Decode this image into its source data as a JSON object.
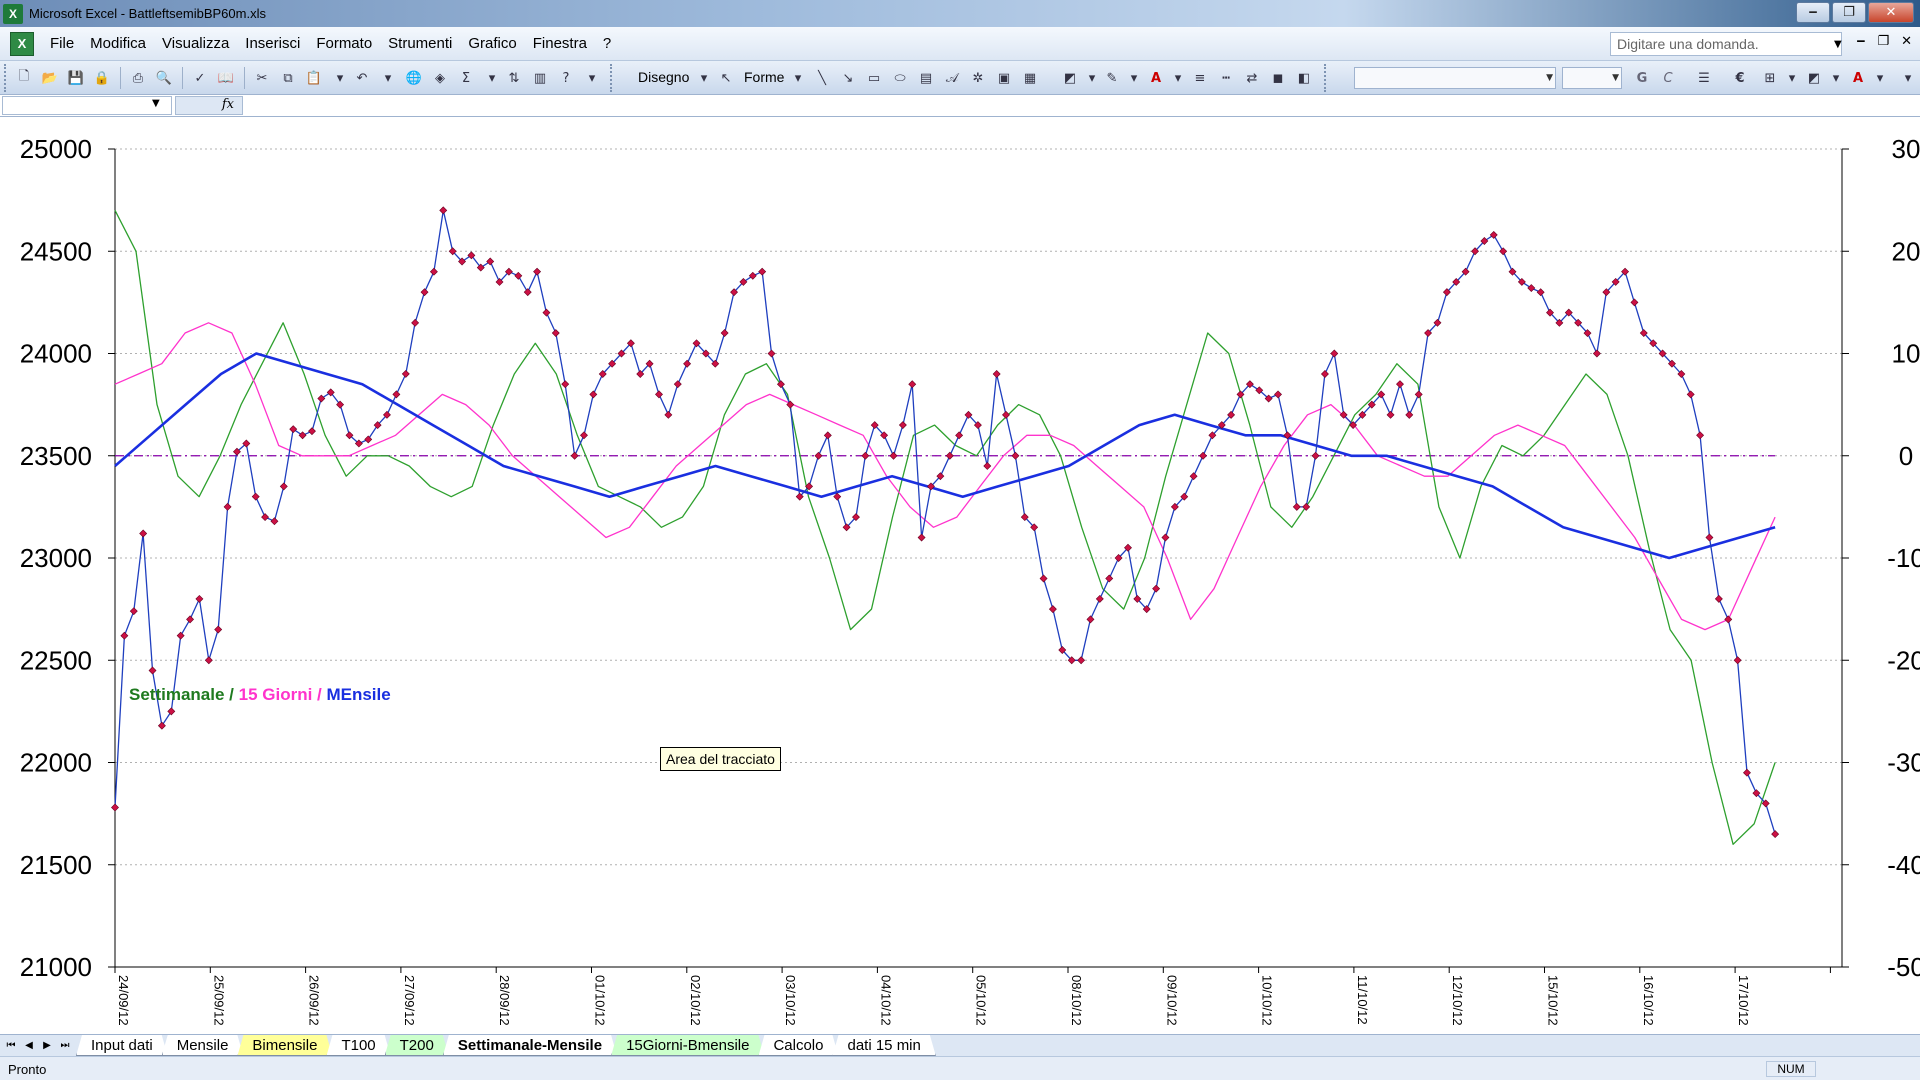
{
  "window": {
    "title": "Microsoft Excel - BattleftsemibBP60m.xls",
    "app_icon": "excel-icon",
    "controls": [
      "minimize-icon",
      "restore-icon",
      "close-icon"
    ]
  },
  "menubar": {
    "items": [
      "File",
      "Modifica",
      "Visualizza",
      "Inserisci",
      "Formato",
      "Strumenti",
      "Grafico",
      "Finestra",
      "?"
    ],
    "ask_placeholder": "Digitare una domanda."
  },
  "toolbar": {
    "draw_label": "Disegno",
    "shapes_label": "Forme",
    "bold_label": "G",
    "italic_label": "C",
    "euro_label": "€",
    "font_color_label": "A"
  },
  "formulabar": {
    "namebox_value": "",
    "fx_label": "fx"
  },
  "colors": {
    "price": "#1f3fbf",
    "markers": "#cc1144",
    "weekly": "#2ea02e",
    "fifteen_days": "#ff33cc",
    "monthly": "#1a2fe0",
    "zero_line": "#8800aa"
  },
  "legend": {
    "weekly": "Settimanale",
    "sep1": " / ",
    "fifteen": "15 Giorni",
    "sep2": " / ",
    "monthly": "MEnsile"
  },
  "tooltip": "Area del tracciato",
  "chart_data": {
    "type": "line",
    "x_dates": [
      "24/09/12",
      "25/09/12",
      "26/09/12",
      "27/09/12",
      "28/09/12",
      "01/10/12",
      "02/10/12",
      "03/10/12",
      "04/10/12",
      "05/10/12",
      "08/10/12",
      "09/10/12",
      "10/10/12",
      "11/10/12",
      "12/10/12",
      "15/10/12",
      "16/10/12",
      "17/10/12"
    ],
    "y_left": {
      "min": 21000,
      "max": 25000,
      "ticks": [
        21000,
        21500,
        22000,
        22500,
        23000,
        23500,
        24000,
        24500,
        25000
      ]
    },
    "y_right": {
      "min": -50,
      "max": 30,
      "ticks": [
        -50,
        -40,
        -30,
        -20,
        -10,
        0,
        10,
        20,
        30
      ]
    },
    "grid": true,
    "series": [
      {
        "role": "price",
        "axis": "left",
        "values": [
          21780,
          22620,
          22740,
          23120,
          22450,
          22180,
          22250,
          22620,
          22700,
          22800,
          22500,
          22650,
          23250,
          23520,
          23560,
          23300,
          23200,
          23180,
          23350,
          23630,
          23600,
          23620,
          23780,
          23810,
          23750,
          23600,
          23560,
          23580,
          23650,
          23700,
          23800,
          23900,
          24150,
          24300,
          24400,
          24700,
          24500,
          24450,
          24480,
          24420,
          24450,
          24350,
          24400,
          24380,
          24300,
          24400,
          24200,
          24100,
          23850,
          23500,
          23600,
          23800,
          23900,
          23950,
          24000,
          24050,
          23900,
          23950,
          23800,
          23700,
          23850,
          23950,
          24050,
          24000,
          23950,
          24100,
          24300,
          24350,
          24380,
          24400,
          24000,
          23850,
          23750,
          23300,
          23350,
          23500,
          23600,
          23300,
          23150,
          23200,
          23500,
          23650,
          23600,
          23500,
          23650,
          23850,
          23100,
          23350,
          23400,
          23500,
          23600,
          23700,
          23650,
          23450,
          23900,
          23700,
          23500,
          23200,
          23150,
          22900,
          22750,
          22550,
          22500,
          22500,
          22700,
          22800,
          22900,
          23000,
          23050,
          22800,
          22750,
          22850,
          23100,
          23250,
          23300,
          23400,
          23500,
          23600,
          23650,
          23700,
          23800,
          23850,
          23820,
          23780,
          23800,
          23600,
          23250,
          23250,
          23500,
          23900,
          24000,
          23700,
          23650,
          23700,
          23750,
          23800,
          23700,
          23850,
          23700,
          23800,
          24100,
          24150,
          24300,
          24350,
          24400,
          24500,
          24550,
          24580,
          24500,
          24400,
          24350,
          24320,
          24300,
          24200,
          24150,
          24200,
          24150,
          24100,
          24000,
          24300,
          24350,
          24400,
          24250,
          24100,
          24050,
          24000,
          23950,
          23900,
          23800,
          23600,
          23100,
          22800,
          22700,
          22500,
          21950,
          21850,
          21800,
          21650
        ]
      },
      {
        "name": "Settimanale",
        "axis": "right",
        "values": [
          24,
          20,
          5,
          -2,
          -4,
          0,
          5,
          9,
          13,
          8,
          2,
          -2,
          0,
          0,
          -1,
          -3,
          -4,
          -3,
          3,
          8,
          11,
          8,
          2,
          -3,
          -4,
          -5,
          -7,
          -6,
          -3,
          4,
          8,
          9,
          6,
          -4,
          -10,
          -17,
          -15,
          -6,
          2,
          3,
          1,
          0,
          3,
          5,
          4,
          0,
          -7,
          -13,
          -15,
          -10,
          -2,
          5,
          12,
          10,
          3,
          -5,
          -7,
          -4,
          0,
          4,
          6,
          9,
          7,
          -5,
          -10,
          -3,
          1,
          0,
          2,
          5,
          8,
          6,
          0,
          -9,
          -17,
          -20,
          -30,
          -38,
          -36,
          -30
        ]
      },
      {
        "name": "15 Giorni",
        "axis": "right",
        "values": [
          7,
          8,
          9,
          12,
          13,
          12,
          7,
          1,
          0,
          0,
          0,
          1,
          2,
          4,
          6,
          5,
          3,
          0,
          -2,
          -4,
          -6,
          -8,
          -7,
          -4,
          -1,
          1,
          3,
          5,
          6,
          5,
          4,
          3,
          2,
          -2,
          -5,
          -7,
          -6,
          -3,
          0,
          2,
          2,
          1,
          -1,
          -3,
          -5,
          -10,
          -16,
          -13,
          -8,
          -3,
          1,
          4,
          5,
          3,
          0,
          -1,
          -2,
          -2,
          0,
          2,
          3,
          2,
          1,
          -2,
          -5,
          -8,
          -12,
          -16,
          -17,
          -16,
          -11,
          -6
        ]
      },
      {
        "name": "MEnsile",
        "axis": "right",
        "values": [
          -1,
          2,
          5,
          8,
          10,
          9,
          8,
          7,
          5,
          3,
          1,
          -1,
          -2,
          -3,
          -4,
          -3,
          -2,
          -1,
          -2,
          -3,
          -4,
          -3,
          -2,
          -3,
          -4,
          -3,
          -2,
          -1,
          1,
          3,
          4,
          3,
          2,
          2,
          1,
          0,
          0,
          -1,
          -2,
          -3,
          -5,
          -7,
          -8,
          -9,
          -10,
          -9,
          -8,
          -7
        ]
      }
    ]
  },
  "sheet_tabs": {
    "nav": [
      "first-icon",
      "prev-icon",
      "next-icon",
      "last-icon"
    ],
    "items": [
      {
        "label": "Input dati",
        "style": "white"
      },
      {
        "label": "Mensile",
        "style": "white"
      },
      {
        "label": "Bimensile",
        "style": "yellow"
      },
      {
        "label": "T100",
        "style": "white"
      },
      {
        "label": "T200",
        "style": "green"
      },
      {
        "label": "Settimanale-Mensile",
        "style": "active"
      },
      {
        "label": "15Giorni-Bmensile",
        "style": "green"
      },
      {
        "label": "Calcolo",
        "style": "white"
      },
      {
        "label": "dati 15 min",
        "style": "white"
      }
    ]
  },
  "statusbar": {
    "text": "Pronto",
    "num": "NUM"
  }
}
